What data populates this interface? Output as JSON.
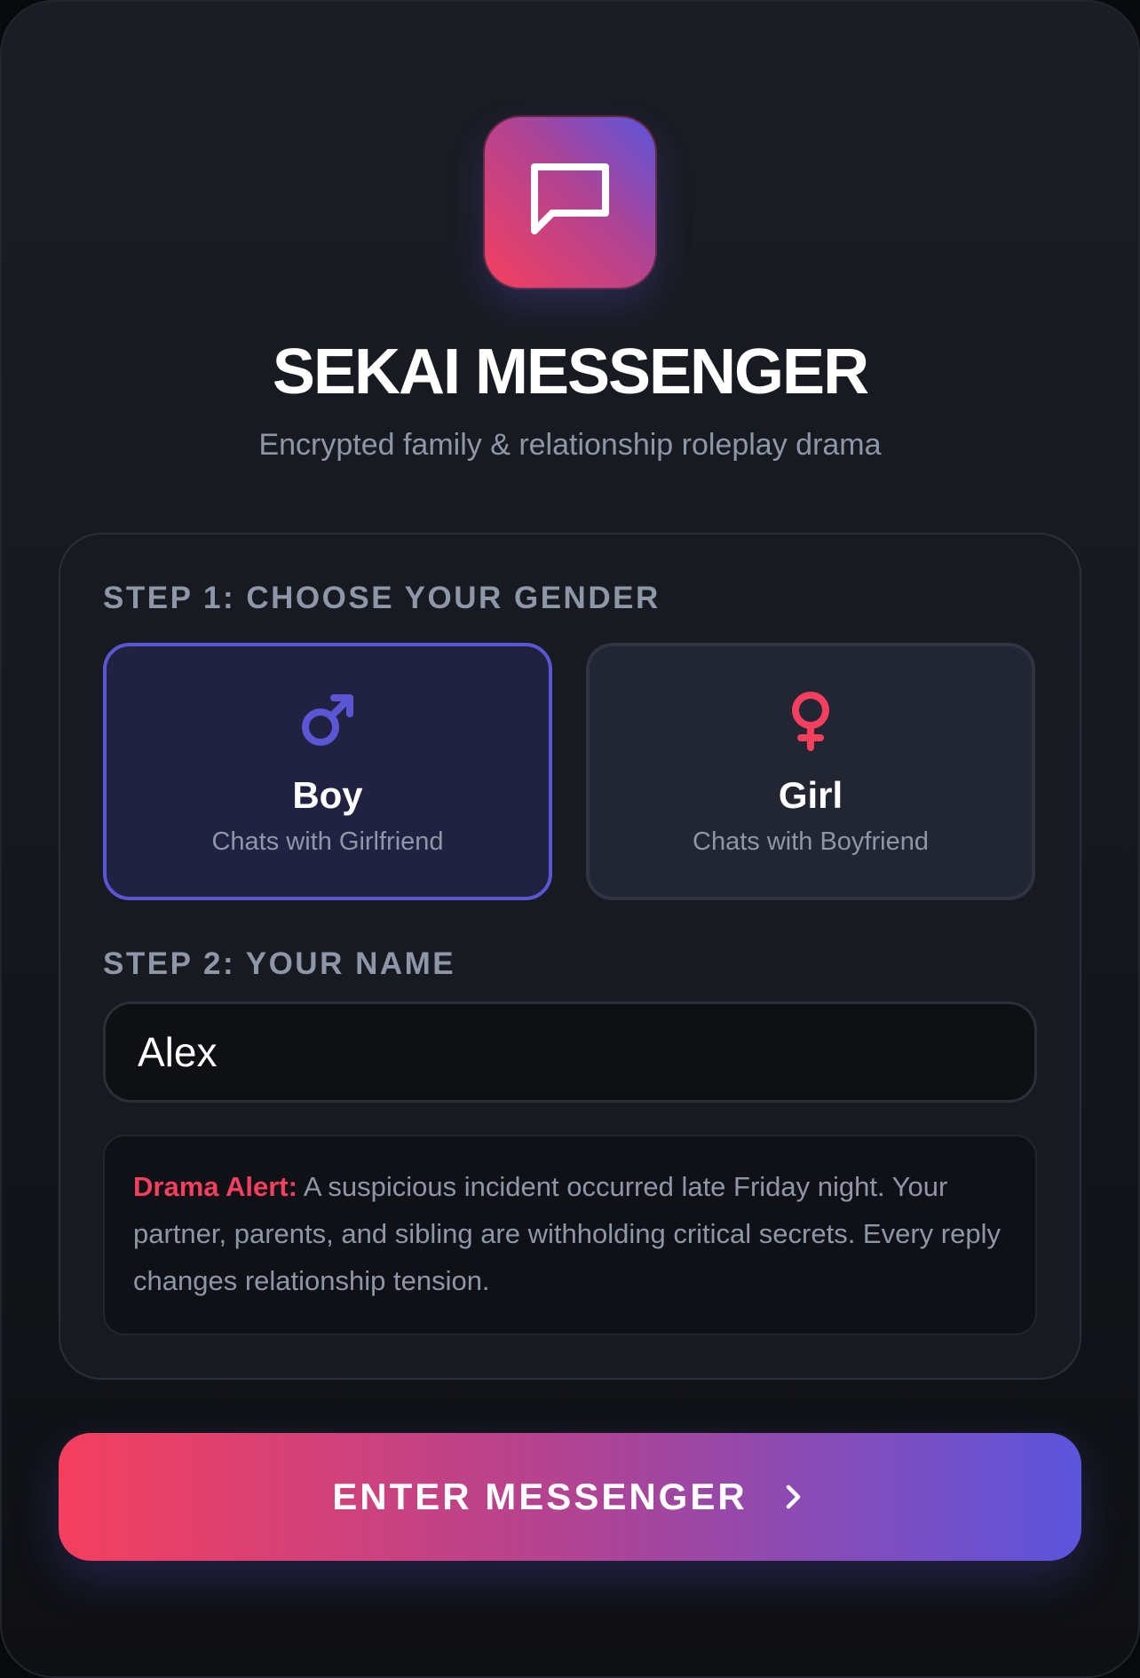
{
  "app": {
    "title": "SEKAI MESSENGER",
    "subtitle": "Encrypted family & relationship roleplay drama",
    "logo_icon": "chat-bubble-icon"
  },
  "step1": {
    "label": "STEP 1: CHOOSE YOUR GENDER",
    "options": [
      {
        "name": "Boy",
        "description": "Chats with Girlfriend",
        "icon": "male-symbol-icon",
        "color": "#5b57d4",
        "selected": true
      },
      {
        "name": "Girl",
        "description": "Chats with Boyfriend",
        "icon": "female-symbol-icon",
        "color": "#f43f5e",
        "selected": false
      }
    ]
  },
  "step2": {
    "label": "STEP 2: YOUR NAME",
    "value": "Alex"
  },
  "alert": {
    "highlight": "Drama Alert:",
    "text": " A suspicious incident occurred late Friday night. Your partner, parents, and sibling are withholding critical secrets. Every reply changes relationship tension."
  },
  "cta": {
    "label": "ENTER MESSENGER",
    "icon": "chevron-right-icon"
  },
  "colors": {
    "accent_pink": "#f43f5e",
    "accent_indigo": "#5b54dc",
    "muted_text": "#8e97a8"
  }
}
